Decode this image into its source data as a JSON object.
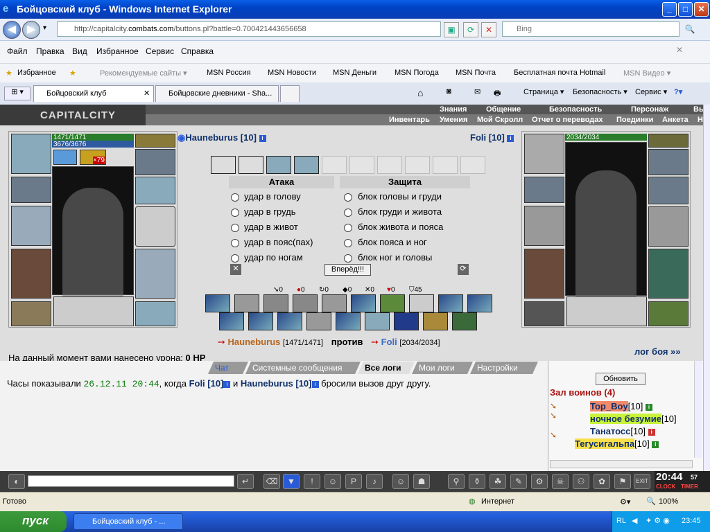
{
  "window": {
    "title": "Бойцовский клуб - Windows Internet Explorer"
  },
  "address": {
    "url_prefix": "http://capitalcity.",
    "url_domain": "combats.com",
    "url_rest": "/buttons.pl?battle=0.700421443656658",
    "search_placeholder": "Bing"
  },
  "menu": [
    "Файл",
    "Правка",
    "Вид",
    "Избранное",
    "Сервис",
    "Справка"
  ],
  "favorites": {
    "label": "Избранное",
    "items": [
      "Рекомендуемые сайты ▾",
      "MSN Россия",
      "MSN Новости",
      "MSN Деньги",
      "MSN Погода",
      "MSN Почта",
      "Бесплатная почта Hotmail",
      "MSN Видео ▾"
    ]
  },
  "tabs": [
    "Бойцовский клуб",
    "Бойцовские дневники - Sha..."
  ],
  "command_bar": [
    "Страница ▾",
    "Безопасность ▾",
    "Сервис ▾"
  ],
  "game": {
    "logo": "CAPITALCITY",
    "nav_top": [
      "Знания",
      "Общение",
      "Безопасность",
      "Персонаж",
      "Вых"
    ],
    "nav_bottom": [
      "Инвентарь",
      "Умения",
      "Мой Скролл",
      "Отчет о переводах",
      "Поединки",
      "Анкета",
      "На"
    ],
    "player1": {
      "name": "Hauneburus [10]",
      "hp": "1471/1471",
      "mp": "3676/3676",
      "item_count": "×79"
    },
    "player2": {
      "name": "Foli [10]",
      "hp": "2034/2034"
    },
    "attack_header": "Атака",
    "defense_header": "Защита",
    "attacks": [
      "удар в голову",
      "удар в грудь",
      "удар в живот",
      "удар в пояс(пах)",
      "удар по ногам"
    ],
    "defenses": [
      "блок головы и груди",
      "блок груди и живота",
      "блок живота и пояса",
      "блок пояса и ног",
      "блок ног и головы"
    ],
    "forward_button": "Вперёд!!!",
    "stats": [
      "0",
      "0",
      "0",
      "0",
      "0",
      "0",
      "45"
    ],
    "vs": {
      "p1_name": "Hauneburus",
      "p1_hp": "[1471/1471]",
      "against": "против",
      "p2_name": "Foli",
      "p2_hp": "[2034/2034]"
    },
    "damage_text": "На данный момент вами нанесено урона:",
    "damage_value": "0 HP",
    "battle_log_link": "лог боя »»"
  },
  "chat": {
    "tabs": [
      "Чат",
      "Системные сообщения",
      "Все логи",
      "Мои логи",
      "Настройки"
    ],
    "message": {
      "pre": "Часы показывали",
      "time": "26.12.11 20:44",
      "mid": ", когда",
      "p2": "Foli [10]",
      "and": "и",
      "p1": "Hauneburus [10]",
      "post": "бросили вызов друг другу."
    }
  },
  "sidebar": {
    "refresh": "Обновить",
    "title": "Зал воинов (4)",
    "warriors": [
      {
        "name": "Top_Boy",
        "level": "[10]",
        "bg": "#f28a6a"
      },
      {
        "name": "ночное безумие",
        "level": "[10]",
        "bg": "#c9f23a"
      },
      {
        "name": "Танатосс",
        "level": "[10]",
        "bg": ""
      },
      {
        "name": "Тегусигальпа",
        "level": "[10]",
        "bg": "#f7e04a"
      }
    ]
  },
  "clock": {
    "time": "20:44",
    "sec": "57",
    "clock_label": "CLOCK",
    "timer_label": "TIMER"
  },
  "status": {
    "text": "Готово",
    "zone": "Интернет",
    "zoom": "100%"
  },
  "taskbar": {
    "start": "пуск",
    "item": "Бойцовский клуб - ...",
    "lang": "RL",
    "time": "23:45"
  }
}
